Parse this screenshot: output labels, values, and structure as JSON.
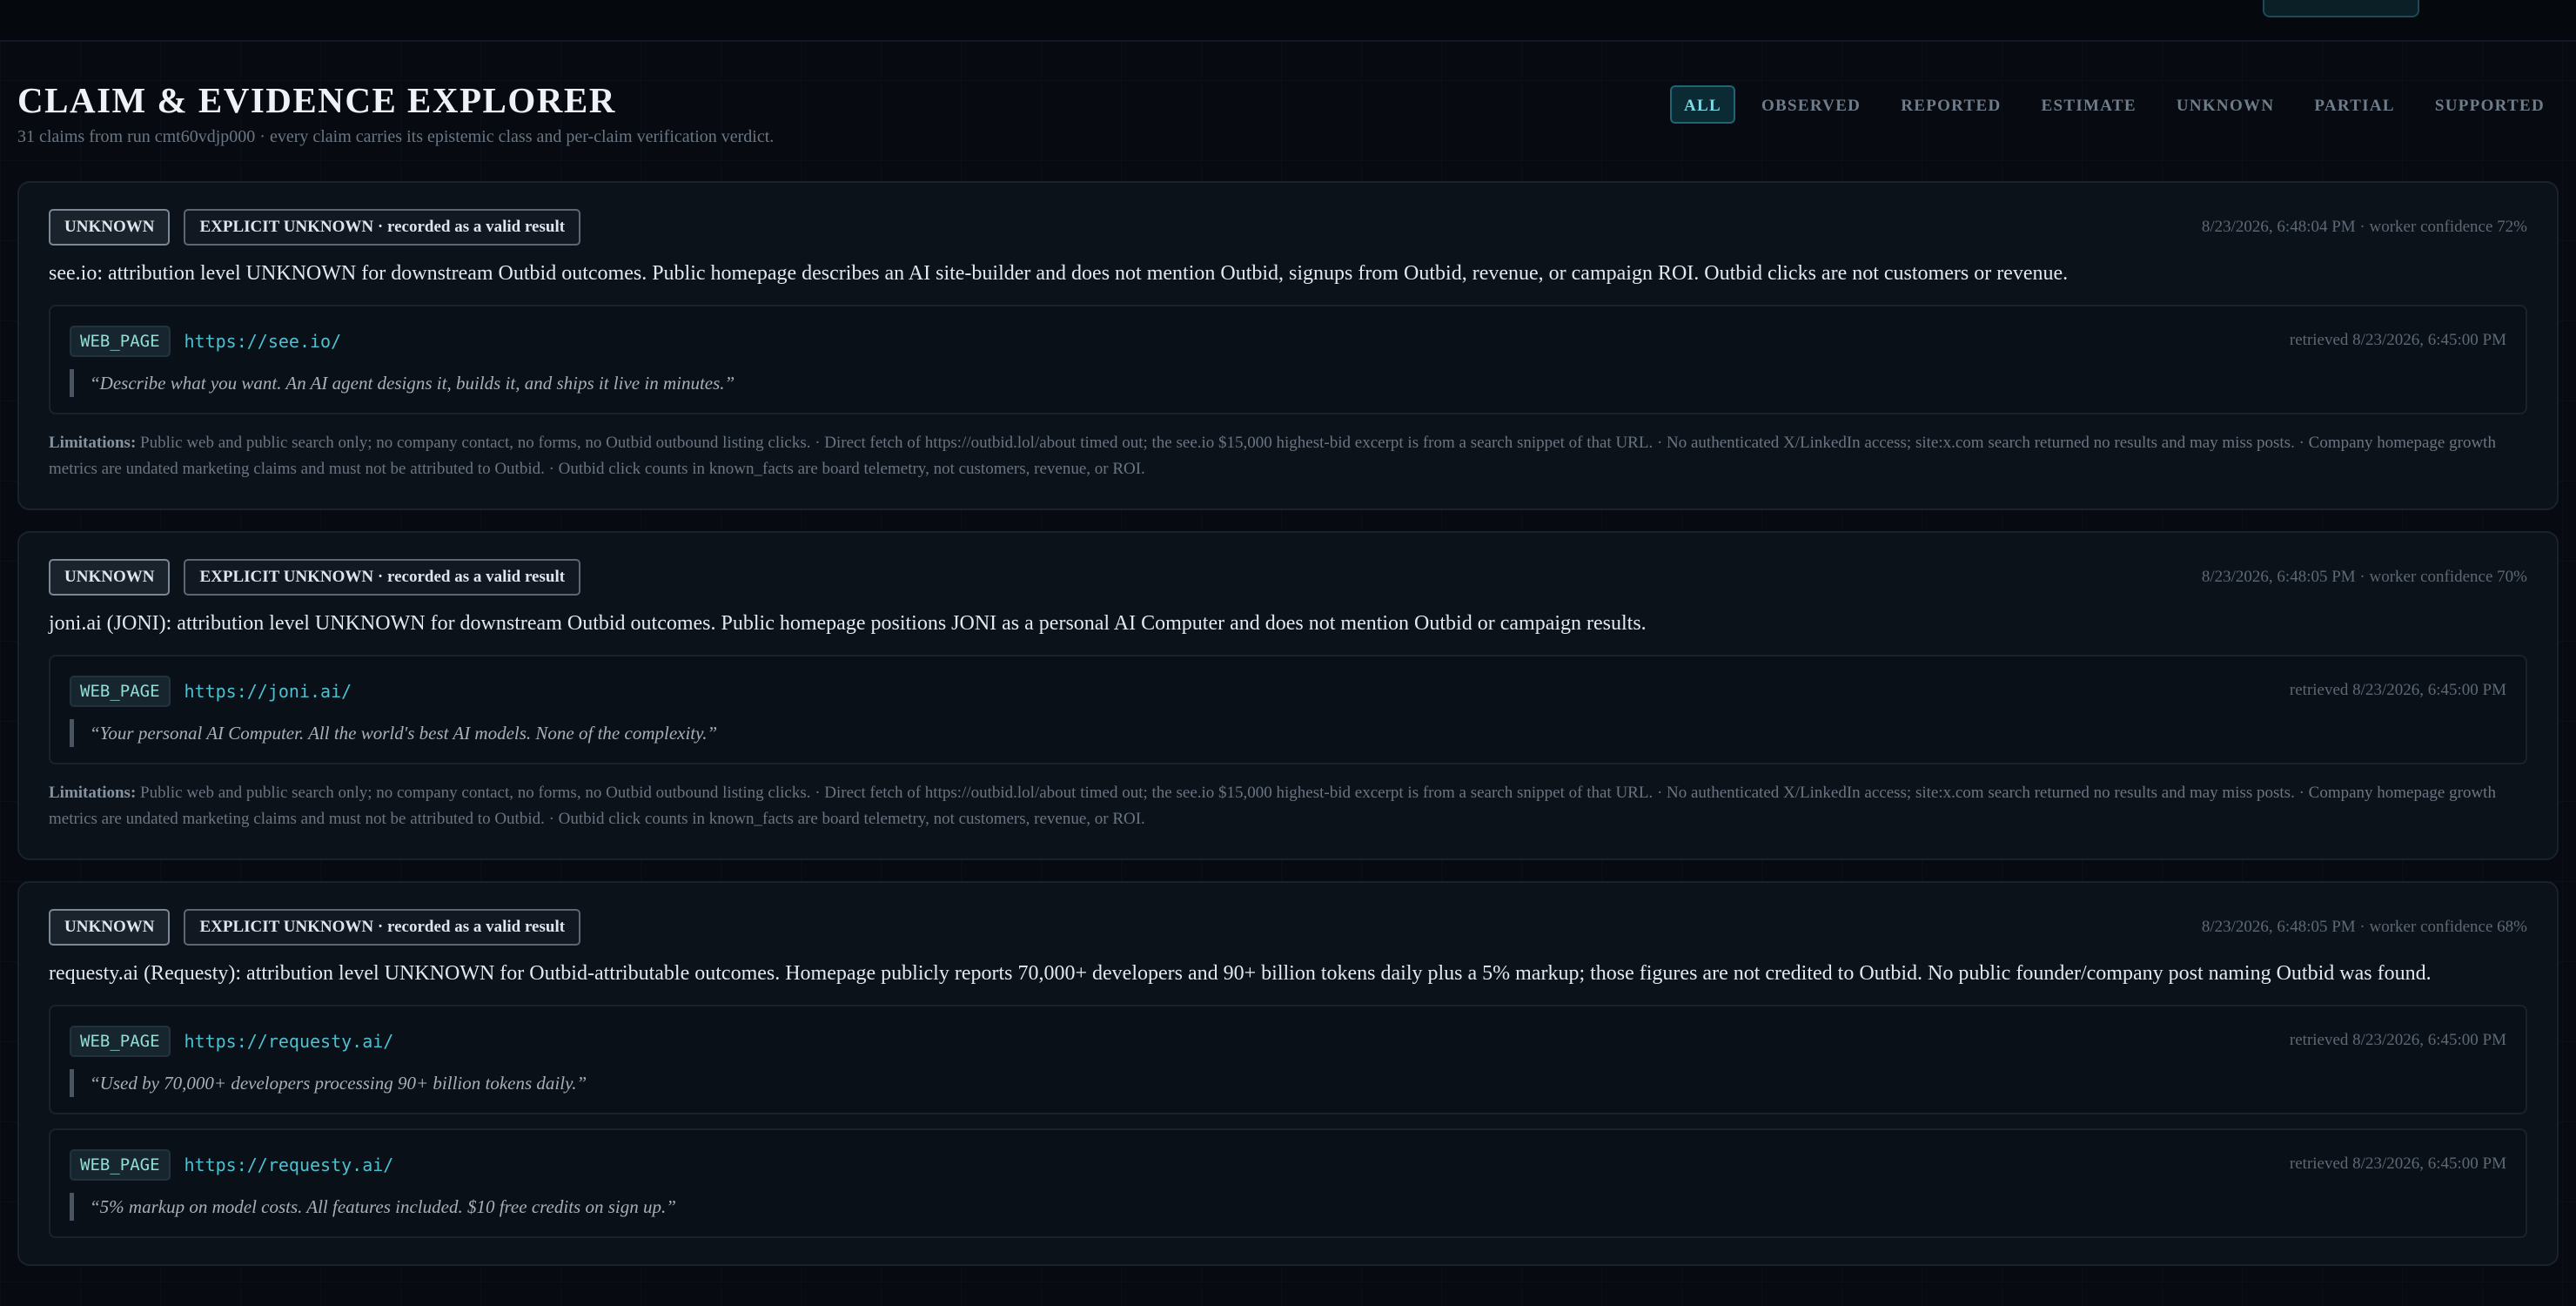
{
  "header": {
    "title": "CLAIM & EVIDENCE EXPLORER",
    "subtitle": "31 claims from run cmt60vdjp000 · every claim carries its epistemic class and per-claim verification verdict."
  },
  "filters": [
    "ALL",
    "OBSERVED",
    "REPORTED",
    "ESTIMATE",
    "UNKNOWN",
    "PARTIAL",
    "SUPPORTED"
  ],
  "active_filter": "ALL",
  "limitations_label": "Limitations:",
  "claims": [
    {
      "class": "UNKNOWN",
      "verdict": "EXPLICIT UNKNOWN · recorded as a valid result",
      "meta": "8/23/2026, 6:48:04 PM · worker confidence 72%",
      "text": "see.io: attribution level UNKNOWN for downstream Outbid outcomes. Public homepage describes an AI site-builder and does not mention Outbid, signups from Outbid, revenue, or campaign ROI. Outbid clicks are not customers or revenue.",
      "evidence": [
        {
          "type": "WEB_PAGE",
          "url": "https://see.io/",
          "retrieved": "retrieved 8/23/2026, 6:45:00 PM",
          "quote": "“Describe what you want. An AI agent designs it, builds it, and ships it live in minutes.”"
        }
      ],
      "limitations": "Public web and public search only; no company contact, no forms, no Outbid outbound listing clicks. · Direct fetch of https://outbid.lol/about timed out; the see.io $15,000 highest-bid excerpt is from a search snippet of that URL. · No authenticated X/LinkedIn access; site:x.com search returned no results and may miss posts. · Company homepage growth metrics are undated marketing claims and must not be attributed to Outbid. · Outbid click counts in known_facts are board telemetry, not customers, revenue, or ROI."
    },
    {
      "class": "UNKNOWN",
      "verdict": "EXPLICIT UNKNOWN · recorded as a valid result",
      "meta": "8/23/2026, 6:48:05 PM · worker confidence 70%",
      "text": "joni.ai (JONI): attribution level UNKNOWN for downstream Outbid outcomes. Public homepage positions JONI as a personal AI Computer and does not mention Outbid or campaign results.",
      "evidence": [
        {
          "type": "WEB_PAGE",
          "url": "https://joni.ai/",
          "retrieved": "retrieved 8/23/2026, 6:45:00 PM",
          "quote": "“Your personal AI Computer. All the world's best AI models. None of the complexity.”"
        }
      ],
      "limitations": "Public web and public search only; no company contact, no forms, no Outbid outbound listing clicks. · Direct fetch of https://outbid.lol/about timed out; the see.io $15,000 highest-bid excerpt is from a search snippet of that URL. · No authenticated X/LinkedIn access; site:x.com search returned no results and may miss posts. · Company homepage growth metrics are undated marketing claims and must not be attributed to Outbid. · Outbid click counts in known_facts are board telemetry, not customers, revenue, or ROI."
    },
    {
      "class": "UNKNOWN",
      "verdict": "EXPLICIT UNKNOWN · recorded as a valid result",
      "meta": "8/23/2026, 6:48:05 PM · worker confidence 68%",
      "text": "requesty.ai (Requesty): attribution level UNKNOWN for Outbid-attributable outcomes. Homepage publicly reports 70,000+ developers and 90+ billion tokens daily plus a 5% markup; those figures are not credited to Outbid. No public founder/company post naming Outbid was found.",
      "evidence": [
        {
          "type": "WEB_PAGE",
          "url": "https://requesty.ai/",
          "retrieved": "retrieved 8/23/2026, 6:45:00 PM",
          "quote": "“Used by 70,000+ developers processing 90+ billion tokens daily.”"
        },
        {
          "type": "WEB_PAGE",
          "url": "https://requesty.ai/",
          "retrieved": "retrieved 8/23/2026, 6:45:00 PM",
          "quote": "“5% markup on model costs. All features included. $10 free credits on sign up.”"
        }
      ],
      "limitations": ""
    }
  ]
}
